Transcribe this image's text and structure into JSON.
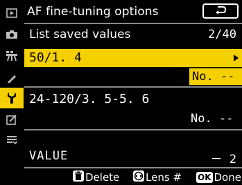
{
  "colors": {
    "accent": "#f5d000",
    "background": "#000000",
    "text": "#ffffff",
    "divider": "#8a8a8a"
  },
  "sidebar": {
    "items": [
      {
        "icon": "playback-icon"
      },
      {
        "icon": "camera-icon"
      },
      {
        "icon": "movie-icon"
      },
      {
        "icon": "pencil-icon"
      },
      {
        "icon": "wrench-icon",
        "active": true
      },
      {
        "icon": "retouch-icon"
      },
      {
        "icon": "my-menu-icon"
      }
    ]
  },
  "header": {
    "title": "AF fine-tuning options",
    "back_icon": "return-icon"
  },
  "saved": {
    "label": "List saved values",
    "count": "2/40"
  },
  "lenses": [
    {
      "name": "50/1. 4",
      "no_label": "No.",
      "no_value": "--"
    },
    {
      "name": "24-120/3. 5-5. 6",
      "no_label": "No.",
      "no_value": "--"
    }
  ],
  "value": {
    "label": "VALUE",
    "amount": "－ 2"
  },
  "footer": {
    "delete_label": "Delete",
    "lens_label": "Lens #",
    "ok_badge": "OK",
    "done_label": "Done"
  }
}
